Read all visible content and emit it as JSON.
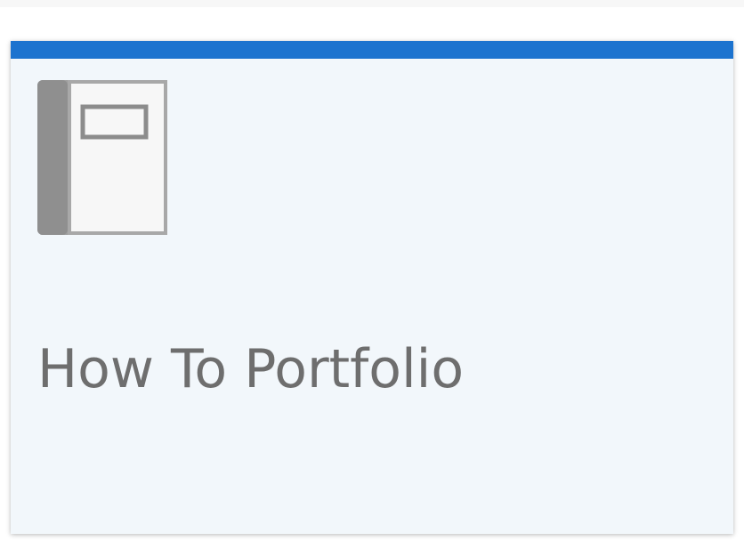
{
  "card": {
    "title": "How To Portfolio",
    "icon": "notebook-icon",
    "accent_color": "#1c73cf",
    "background_color": "#f2f7fb",
    "title_color": "#6e6e6e"
  }
}
